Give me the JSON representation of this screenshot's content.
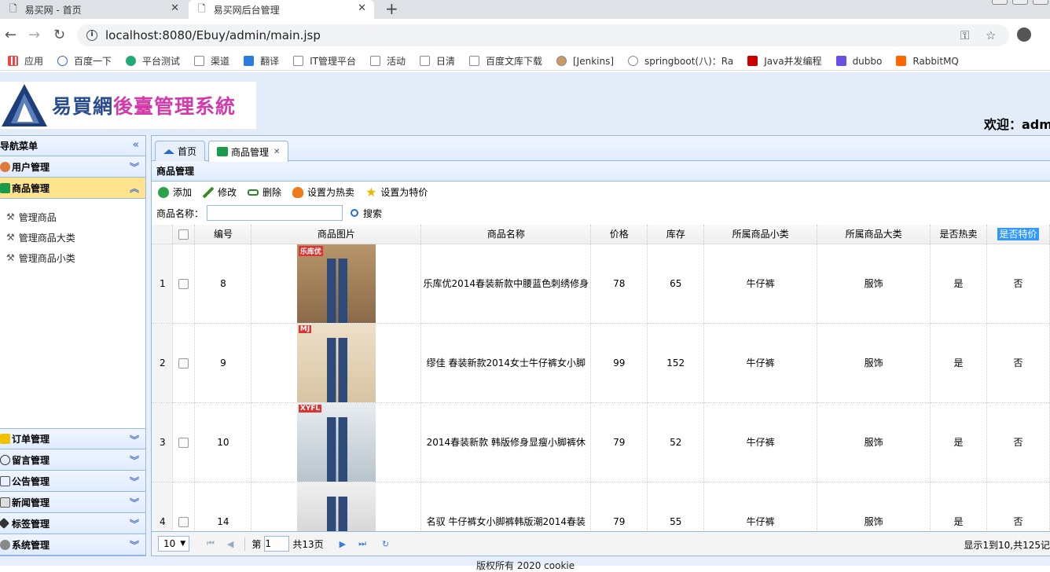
{
  "browser": {
    "tabs": [
      {
        "title": "易买网 - 首页"
      },
      {
        "title": "易买网后台管理"
      }
    ],
    "url": "localhost:8080/Ebuy/admin/main.jsp",
    "bookmarks": [
      "应用",
      "百度一下",
      "平台测试",
      "渠道",
      "翻译",
      "IT管理平台",
      "活动",
      "日清",
      "百度文库下载",
      "[Jenkins]",
      "springboot(八)：Ra",
      "Java并发编程",
      "dubbo",
      "RabbitMQ"
    ]
  },
  "header": {
    "logo_text_a": "易買網",
    "logo_text_b": "後臺管理系統",
    "welcome": "欢迎：admi"
  },
  "leftnav": {
    "title": "导航菜单",
    "sections_top": [
      {
        "label": "用户管理",
        "active": false
      },
      {
        "label": "商品管理",
        "active": true
      }
    ],
    "subitems": [
      "管理商品",
      "管理商品大类",
      "管理商品小类"
    ],
    "sections_bottom": [
      "订单管理",
      "留言管理",
      "公告管理",
      "新闻管理",
      "标签管理",
      "系统管理"
    ]
  },
  "main": {
    "tabs": [
      {
        "label": "首页"
      },
      {
        "label": "商品管理"
      }
    ],
    "panel_title": "商品管理",
    "toolbar": {
      "add": "添加",
      "edit": "修改",
      "delete": "删除",
      "set_hot": "设置为热卖",
      "set_special": "设置为特价"
    },
    "search": {
      "label": "商品名称：",
      "value": "",
      "button": "搜索"
    },
    "columns": [
      "编号",
      "商品图片",
      "商品名称",
      "价格",
      "库存",
      "所属商品小类",
      "所属商品大类",
      "是否热卖",
      "是否特价"
    ],
    "rows": [
      {
        "rn": "1",
        "id": "8",
        "name": "乐库优2014春装新款中腰蓝色刺绣修身",
        "price": "78",
        "stock": "65",
        "small": "牛仔裤",
        "big": "服饰",
        "hot": "是",
        "special": "否",
        "img_label": "乐库优"
      },
      {
        "rn": "2",
        "id": "9",
        "name": "缪佳 春装新款2014女士牛仔裤女小脚",
        "price": "99",
        "stock": "152",
        "small": "牛仔裤",
        "big": "服饰",
        "hot": "是",
        "special": "否",
        "img_label": "MJ"
      },
      {
        "rn": "3",
        "id": "10",
        "name": "2014春装新款 韩版修身显瘦小脚裤休",
        "price": "79",
        "stock": "52",
        "small": "牛仔裤",
        "big": "服饰",
        "hot": "是",
        "special": "否",
        "img_label": "XYFL"
      },
      {
        "rn": "4",
        "id": "14",
        "name": "名驭 牛仔裤女小脚裤韩版潮2014春装",
        "price": "79",
        "stock": "55",
        "small": "牛仔裤",
        "big": "服饰",
        "hot": "是",
        "special": "否",
        "img_label": ""
      }
    ],
    "pager": {
      "page_size": "10",
      "page_prefix": "第",
      "page": "1",
      "page_total": "共13页",
      "info": "显示1到10,共125记"
    }
  },
  "footer": "版权所有 2020 cookie",
  "colors": {
    "accent": "#95b8e7",
    "active_section": "#ffe48d",
    "header_bg": "#e3edfa"
  }
}
